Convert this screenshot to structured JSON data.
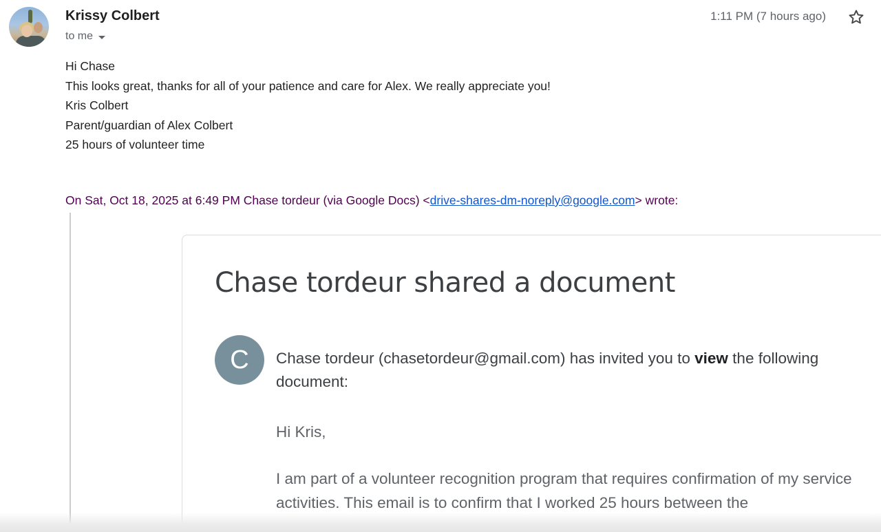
{
  "sender": {
    "name": "Krissy Colbert",
    "recipient_label": "to me",
    "timestamp": "1:11 PM (7 hours ago)",
    "avatar_icon": "profile-photo"
  },
  "body": {
    "lines": [
      "Hi Chase",
      "This looks great, thanks for all of your patience and care for Alex. We really appreciate you!",
      "Kris Colbert",
      "Parent/guardian of Alex Colbert",
      "25 hours of volunteer time"
    ]
  },
  "quote": {
    "prefix": "On Sat, Oct 18, 2025 at 6:49 PM Chase tordeur (via Google Docs) <",
    "email_link": "drive-shares-dm-noreply@google.com",
    "suffix": "> wrote:"
  },
  "card": {
    "title": "Chase tordeur shared a document",
    "avatar_letter": "C",
    "invite_before": "Chase tordeur (chasetordeur@gmail.com) has invited you to ",
    "invite_bold": "view",
    "invite_after": " the following document:",
    "message_lines": [
      "Hi Kris,",
      "I am part of a volunteer recognition program that requires confirmation of my service activities. This email is to confirm that I worked 25 hours between the"
    ]
  },
  "colors": {
    "quote_header": "#500050",
    "link": "#1155cc",
    "card_avatar": "#78909c"
  }
}
